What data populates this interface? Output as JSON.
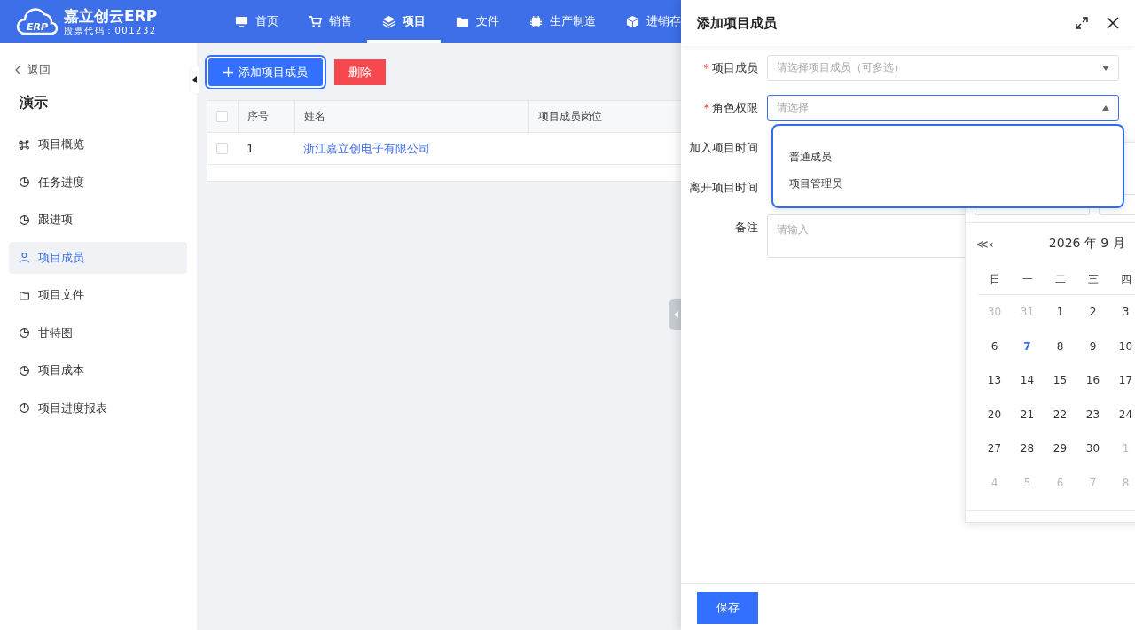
{
  "header": {
    "logo_text": "ERP",
    "brand": "嘉立创云ERP",
    "stock_code": "股票代码：001232",
    "nav": [
      {
        "label": "首页",
        "selected": false
      },
      {
        "label": "销售",
        "selected": false
      },
      {
        "label": "项目",
        "selected": true
      },
      {
        "label": "文件",
        "selected": false
      },
      {
        "label": "生产制造",
        "selected": false
      },
      {
        "label": "进销存",
        "selected": false
      }
    ]
  },
  "sidebar": {
    "back": "返回",
    "title": "演示",
    "items": [
      {
        "label": "项目概览",
        "kind": "overview",
        "selected": false
      },
      {
        "label": "任务进度",
        "kind": "report",
        "selected": false
      },
      {
        "label": "跟进项",
        "kind": "report",
        "selected": false
      },
      {
        "label": "项目成员",
        "kind": "members",
        "selected": true
      },
      {
        "label": "项目文件",
        "kind": "files",
        "selected": false
      },
      {
        "label": "甘特图",
        "kind": "report",
        "selected": false
      },
      {
        "label": "项目成本",
        "kind": "report",
        "selected": false
      },
      {
        "label": "项目进度报表",
        "kind": "report",
        "selected": false
      }
    ]
  },
  "toolbar": {
    "buttons": [
      {
        "label": "添加项目成员",
        "kind": "primary"
      },
      {
        "label": "删除",
        "kind": "danger"
      }
    ]
  },
  "table": {
    "header_checked": false,
    "columns": [
      "序号",
      "姓名",
      "项目成员岗位"
    ],
    "rows": [
      {
        "checked": false,
        "index": "1",
        "name": "浙江嘉立创电子有限公司"
      }
    ]
  },
  "drawer": {
    "title": "添加项目成员",
    "form": [
      {
        "label": "项目成员",
        "required_mark": "*",
        "kind": "select",
        "placeholder": "请选择项目成员（可多选）",
        "open": false
      },
      {
        "label": "角色权限",
        "required_mark": "*",
        "kind": "select",
        "placeholder": "请选择",
        "open": true
      },
      {
        "label": "加入项目时间",
        "kind": "date"
      },
      {
        "label": "离开项目时间",
        "kind": "date"
      },
      {
        "label": "备注",
        "kind": "textarea",
        "placeholder": "请输入"
      }
    ],
    "dropdown": {
      "options": [
        {
          "label": "普通成员",
          "selected": false
        },
        {
          "label": "项目管理员",
          "selected": false
        }
      ]
    },
    "calendar": {
      "prev_year": "≪",
      "prev_month": "‹",
      "title": "2026 年 9 月",
      "weekdays": [
        "日",
        "一",
        "二",
        "三",
        "四"
      ],
      "weeks": [
        [
          {
            "day": "30",
            "muted": true,
            "today": false
          },
          {
            "day": "31",
            "muted": true,
            "today": false
          },
          {
            "day": "1",
            "muted": false,
            "today": false
          },
          {
            "day": "2",
            "muted": false,
            "today": false
          },
          {
            "day": "3",
            "muted": false,
            "today": false
          }
        ],
        [
          {
            "day": "6",
            "muted": false,
            "today": false
          },
          {
            "day": "7",
            "muted": false,
            "today": true
          },
          {
            "day": "8",
            "muted": false,
            "today": false
          },
          {
            "day": "9",
            "muted": false,
            "today": false
          },
          {
            "day": "10",
            "muted": false,
            "today": false
          }
        ],
        [
          {
            "day": "13",
            "muted": false,
            "today": false
          },
          {
            "day": "14",
            "muted": false,
            "today": false
          },
          {
            "day": "15",
            "muted": false,
            "today": false
          },
          {
            "day": "16",
            "muted": false,
            "today": false
          },
          {
            "day": "17",
            "muted": false,
            "today": false
          }
        ],
        [
          {
            "day": "20",
            "muted": false,
            "today": false
          },
          {
            "day": "21",
            "muted": false,
            "today": false
          },
          {
            "day": "22",
            "muted": false,
            "today": false
          },
          {
            "day": "23",
            "muted": false,
            "today": false
          },
          {
            "day": "24",
            "muted": false,
            "today": false
          }
        ],
        [
          {
            "day": "27",
            "muted": false,
            "today": false
          },
          {
            "day": "28",
            "muted": false,
            "today": false
          },
          {
            "day": "29",
            "muted": false,
            "today": false
          },
          {
            "day": "30",
            "muted": false,
            "today": false
          },
          {
            "day": "1",
            "muted": true,
            "today": false
          }
        ],
        [
          {
            "day": "4",
            "muted": true,
            "today": false
          },
          {
            "day": "5",
            "muted": true,
            "today": false
          },
          {
            "day": "6",
            "muted": true,
            "today": false
          },
          {
            "day": "7",
            "muted": true,
            "today": false
          },
          {
            "day": "8",
            "muted": true,
            "today": false
          }
        ]
      ]
    },
    "save": "保存"
  }
}
